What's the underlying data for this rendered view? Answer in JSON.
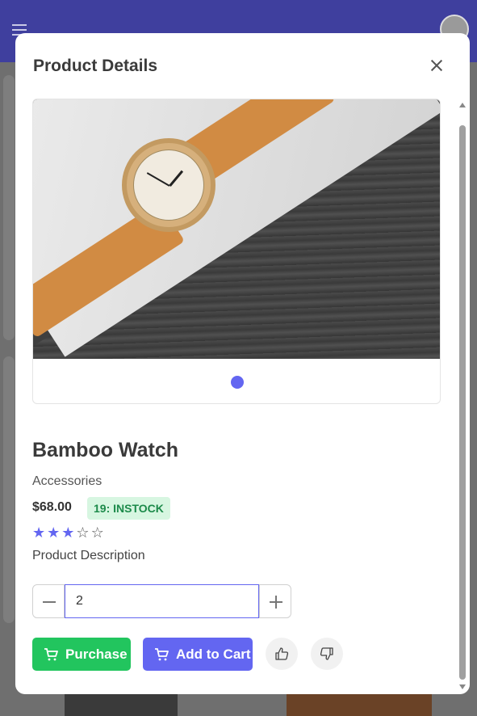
{
  "modal": {
    "title": "Product Details"
  },
  "product": {
    "name": "Bamboo Watch",
    "category": "Accessories",
    "price": "$68.00",
    "stock_badge": "19: INSTOCK",
    "rating": 3,
    "rating_max": 5,
    "description_label": "Product Description"
  },
  "gallery": {
    "image_alt": "Bamboo Watch",
    "indicator_count": 1,
    "active_indicator": 0
  },
  "quantity": {
    "value": "2"
  },
  "actions": {
    "purchase_label": "Purchase",
    "add_to_cart_label": "Add to Cart"
  },
  "icons": {
    "menu": "hamburger-icon",
    "close": "close-icon",
    "cart": "cart-icon",
    "like": "thumbs-up-icon",
    "dislike": "thumbs-down-icon",
    "minus": "minus-icon",
    "plus": "plus-icon"
  },
  "colors": {
    "primary": "#6366f1",
    "success": "#22c55e",
    "badge_bg": "#d7f6e1",
    "badge_text": "#1c8a4a",
    "header": "#3f3f9e"
  }
}
